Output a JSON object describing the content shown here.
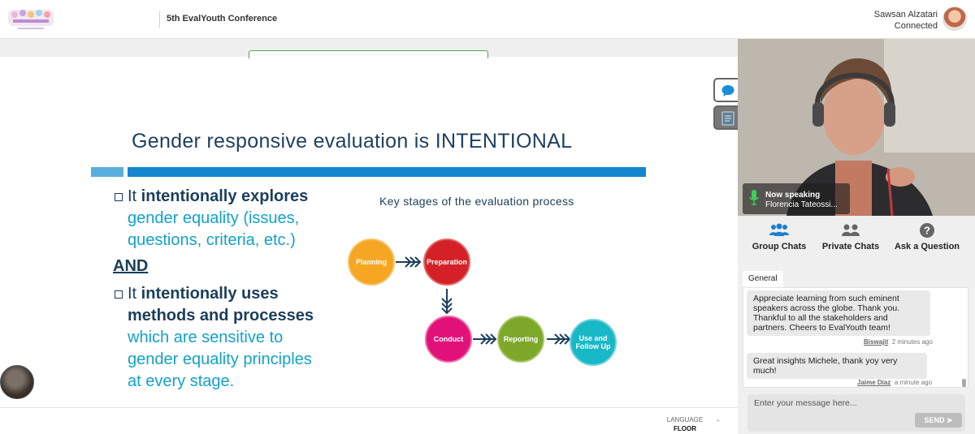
{
  "header": {
    "conference_title": "5th EvalYouth Conference",
    "user_name": "Sawsan Alzatari",
    "user_status": "Connected"
  },
  "slide": {
    "title": "Gender responsive evaluation is INTENTIONAL",
    "bullet1": {
      "line1_plain": "It ",
      "line1_bold": "intentionally explores",
      "line2": "gender equality (issues,",
      "line3": "questions, criteria, etc.)"
    },
    "and_label": "AND",
    "bullet2": {
      "line1_plain": "It ",
      "line1_bold": "intentionally uses",
      "line2": "methods and processes",
      "line3": "which are sensitive to",
      "line4": "gender equality principles",
      "line5": "at every stage."
    },
    "diagram_title": "Key stages of the evaluation process",
    "stages": [
      {
        "label": "Planning",
        "color": "#f6a623"
      },
      {
        "label": "Preparation",
        "color": "#d42127"
      },
      {
        "label": "Conduct",
        "color": "#e2117a"
      },
      {
        "label": "Reporting",
        "color": "#7ea829"
      },
      {
        "label": "Use and",
        "label2": "Follow Up",
        "color": "#19b8c6"
      }
    ]
  },
  "language": {
    "label": "LANGUAGE",
    "value": "FLOOR"
  },
  "video": {
    "now_speaking": "Now speaking",
    "speaker_name": "Florencia Tateossi..."
  },
  "chat": {
    "tabs": [
      {
        "label": "Group Chats",
        "icon": "group-icon"
      },
      {
        "label": "Private Chats",
        "icon": "private-chat-icon"
      },
      {
        "label": "Ask a Question",
        "icon": "question-icon"
      }
    ],
    "channel": "General",
    "messages": [
      {
        "text": "Appreciate learning from such eminent speakers across the globe. Thank you. Thankful to all the stakeholders and partners. Cheers to EvalYouth team!",
        "author": "Biswajit",
        "time": "2 minutes ago"
      },
      {
        "text": "Great insights Michele, thank yoy very much!",
        "author": "Jaime Díaz",
        "time": "a minute ago"
      }
    ],
    "input_placeholder": "Enter your message here...",
    "send_label": "SEND"
  }
}
